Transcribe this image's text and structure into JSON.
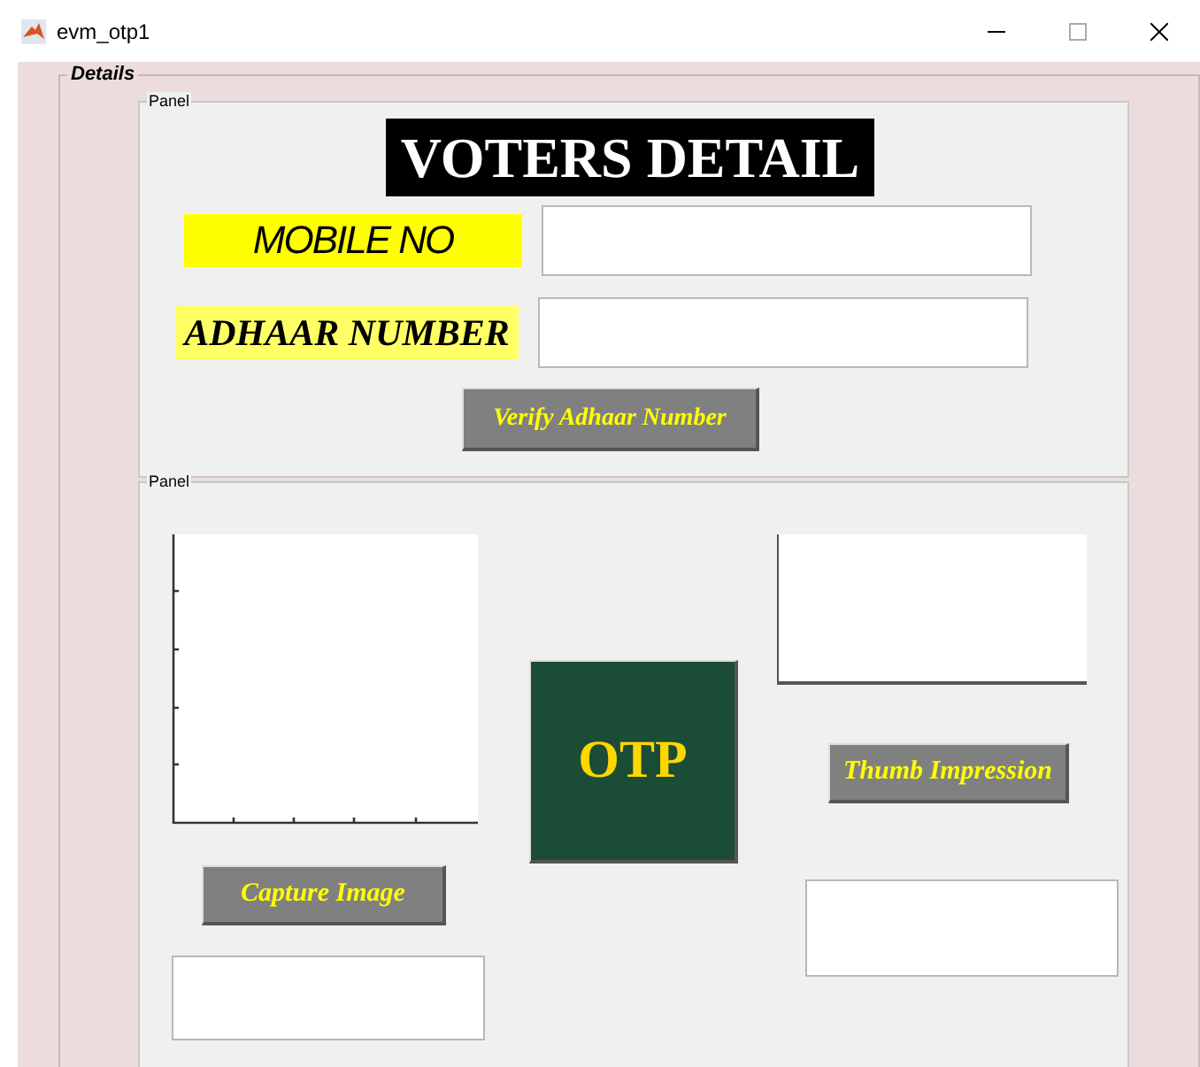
{
  "window": {
    "title": "evm_otp1"
  },
  "details": {
    "legend": "Details",
    "voter_panel": {
      "legend": "Panel",
      "heading": "VOTERS DETAIL",
      "fields": [
        {
          "kind": "sans",
          "label": "MOBILE NO"
        },
        {
          "kind": "serif",
          "label": "ADHAAR NUMBER"
        }
      ],
      "verify_button": "Verify Adhaar Number"
    },
    "capture_panel": {
      "legend": "Panel",
      "capture_button": "Capture Image",
      "otp_button": "OTP",
      "thumb_button": "Thumb Impression"
    }
  }
}
